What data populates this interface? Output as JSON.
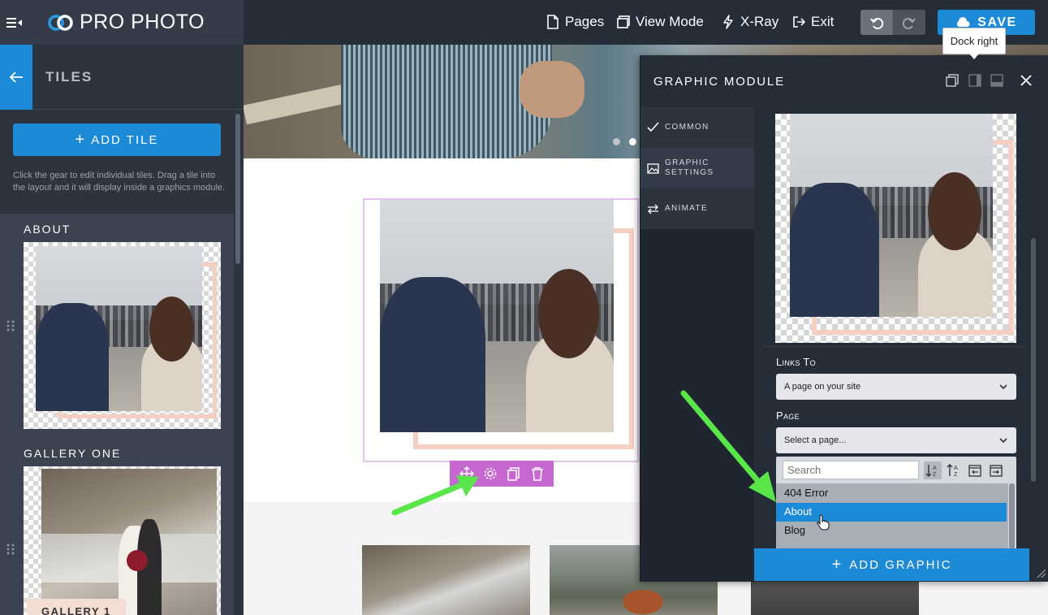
{
  "topbar": {
    "logo_text": "PRO PHOTO",
    "nav": {
      "pages": "Pages",
      "view_mode": "View Mode",
      "xray": "X-Ray",
      "exit": "Exit"
    },
    "save_label": "SAVE",
    "tooltip": "Dock right"
  },
  "sidebar": {
    "title": "TILES",
    "add_tile_label": "ADD TILE",
    "help_text": "Click the gear to edit individual tiles. Drag a tile into the layout and it will display inside a graphics module.",
    "tiles": [
      {
        "label": "ABOUT"
      },
      {
        "label": "GALLERY ONE",
        "caption": "GALLERY 1"
      }
    ]
  },
  "panel": {
    "title": "GRAPHIC MODULE",
    "tabs": [
      {
        "label": "COMMON",
        "icon": "check-icon"
      },
      {
        "label": "GRAPHIC SETTINGS",
        "icon": "image-icon"
      },
      {
        "label": "ANIMATE",
        "icon": "swap-arrows-icon"
      }
    ],
    "links_to": {
      "label": "Links To",
      "value": "A page on your site"
    },
    "page": {
      "label": "Page",
      "value": "Select a page..."
    },
    "search_placeholder": "Search",
    "page_options": [
      "404 Error",
      "About",
      "Blog"
    ],
    "selected_option": "About",
    "add_graphic_label": "ADD GRAPHIC"
  },
  "colors": {
    "accent_blue": "#1c8ad6",
    "toolbar_purple": "#c668cf",
    "annotation_arrow": "#5ae64a",
    "frame_peach": "#f5cfc2",
    "dark_bg": "#252d38"
  }
}
